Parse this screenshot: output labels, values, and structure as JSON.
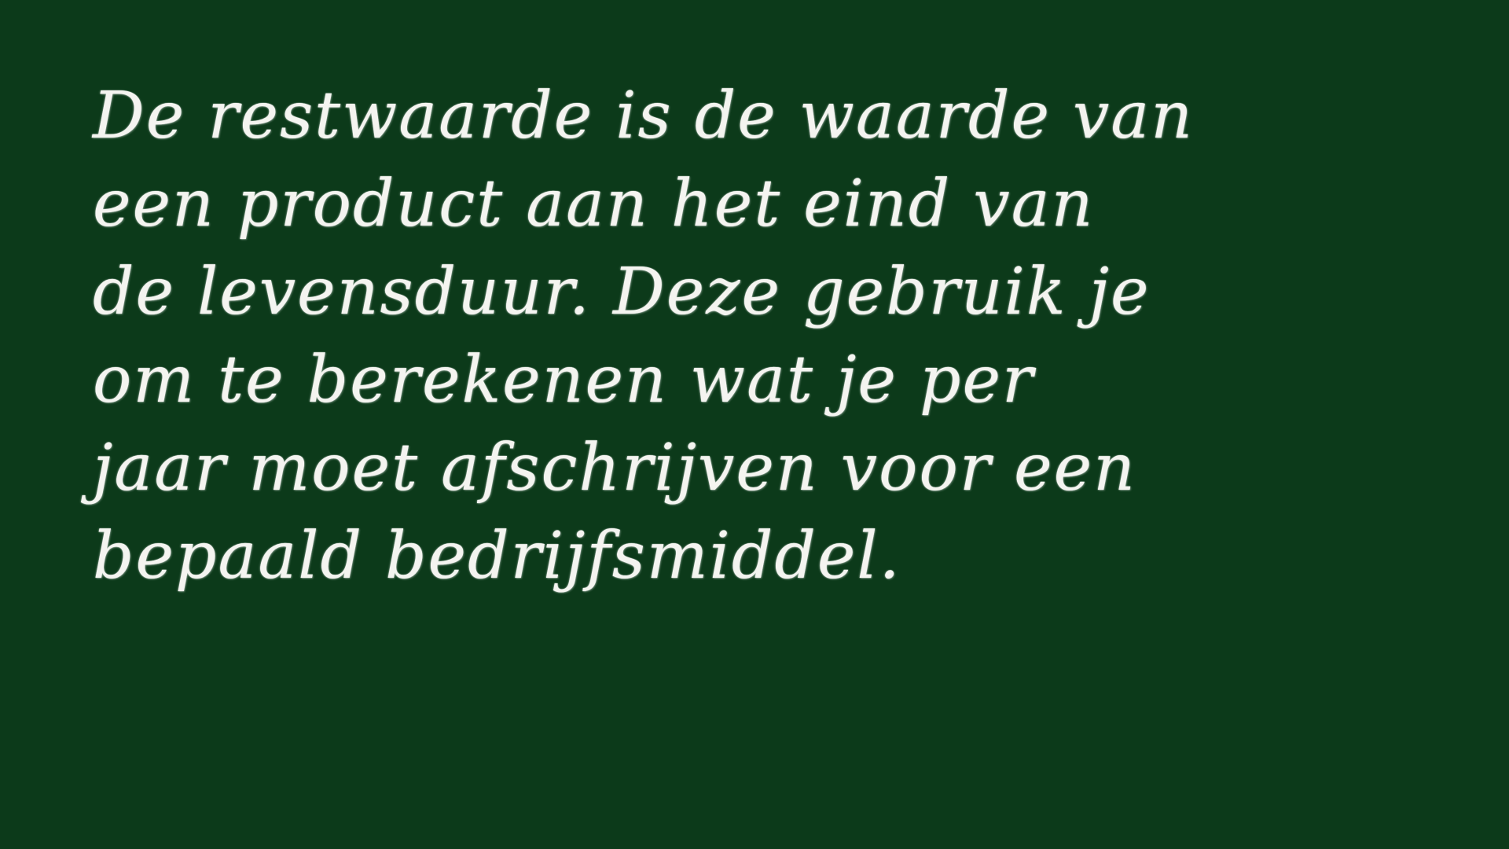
{
  "slide": {
    "lines": [
      "De restwaarde is de waarde van",
      "een product aan het eind van",
      "de levensduur. Deze gebruik je",
      "om te berekenen wat je per",
      "jaar moet afschrijven voor een",
      "bepaald bedrijfsmiddel."
    ]
  },
  "colors": {
    "background": "#0c3a1a",
    "text": "#f4f4f0"
  }
}
